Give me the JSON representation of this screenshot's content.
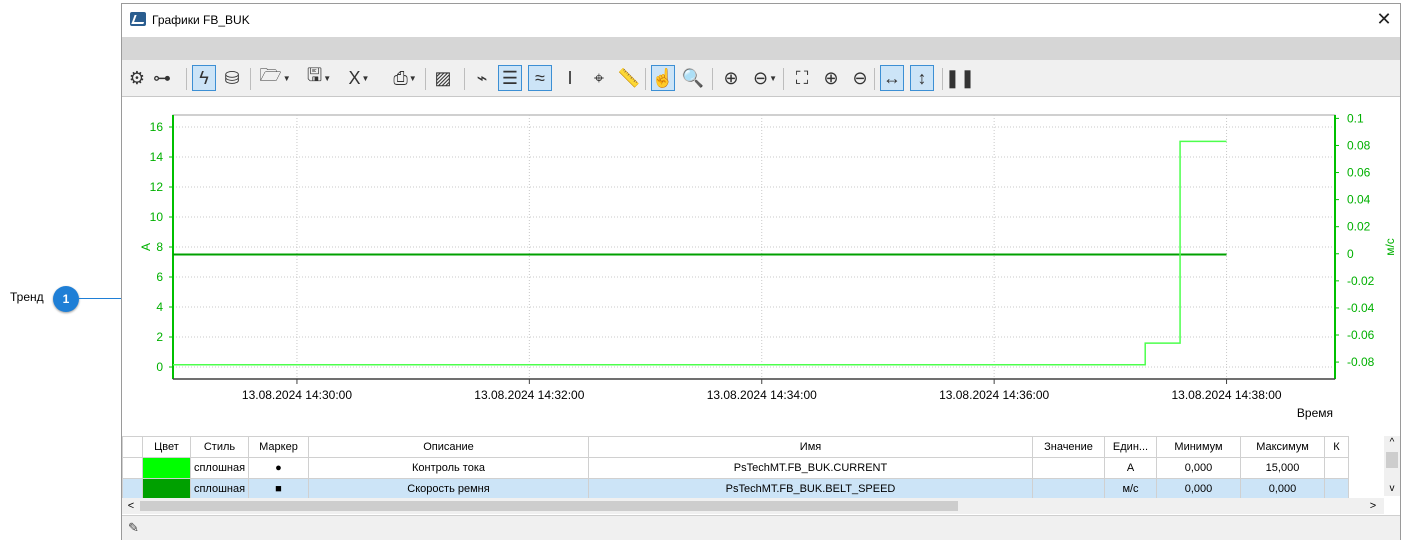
{
  "callout": {
    "label": "Тренд",
    "number": "1"
  },
  "window": {
    "title": "Графики FB_BUK",
    "close": "✕"
  },
  "toolbar": {
    "tools": [
      {
        "icon": "gear-icon",
        "glyph": "⚙"
      },
      {
        "icon": "tree-icon",
        "glyph": "⊶"
      },
      {
        "icon": "lightning-icon",
        "glyph": "ϟ",
        "active": true
      },
      {
        "icon": "database-icon",
        "glyph": "⛁"
      },
      {
        "icon": "folder-open-icon",
        "glyph": "🗁",
        "dropdown": true
      },
      {
        "icon": "save-icon",
        "glyph": "🖫",
        "dropdown": true
      },
      {
        "icon": "excel-icon",
        "glyph": "X",
        "dropdown": true
      },
      {
        "icon": "print-icon",
        "glyph": "⎙",
        "dropdown": true
      },
      {
        "icon": "image-icon",
        "glyph": "▨"
      },
      {
        "icon": "pulse-icon",
        "glyph": "⌁"
      },
      {
        "icon": "list-icon",
        "glyph": "☰",
        "active": true
      },
      {
        "icon": "trend-lines-icon",
        "glyph": "≈",
        "active": true
      },
      {
        "icon": "cursor-text-icon",
        "glyph": "I"
      },
      {
        "icon": "crosshair-icon",
        "glyph": "⌖"
      },
      {
        "icon": "ruler-icon",
        "glyph": "📏"
      },
      {
        "icon": "hand-pointer-icon",
        "glyph": "☝",
        "active": true
      },
      {
        "icon": "magnifier-icon",
        "glyph": "🔍"
      },
      {
        "icon": "add-marker-icon",
        "glyph": "⊕"
      },
      {
        "icon": "remove-marker-icon",
        "glyph": "⊖",
        "dropdown": true
      },
      {
        "icon": "fit-all-icon",
        "glyph": "⛶"
      },
      {
        "icon": "zoom-in-icon",
        "glyph": "⊕"
      },
      {
        "icon": "zoom-out-icon",
        "glyph": "⊖"
      },
      {
        "icon": "horizontal-scale-icon",
        "glyph": "↔",
        "active": true
      },
      {
        "icon": "vertical-scale-icon",
        "glyph": "↕",
        "active": true
      },
      {
        "icon": "pause-icon",
        "glyph": "❚❚"
      }
    ]
  },
  "chart_data": {
    "type": "line",
    "xlabel": "Время",
    "ylabel_left": "А",
    "ylabel_right": "м/с",
    "x_ticks": [
      "13.08.2024 14:30:00",
      "13.08.2024 14:32:00",
      "13.08.2024 14:34:00",
      "13.08.2024 14:36:00",
      "13.08.2024 14:38:00"
    ],
    "x_range": [
      "13.08.2024 14:28:56",
      "13.08.2024 14:38:56"
    ],
    "y_left": {
      "ticks": [
        "0",
        "2",
        "4",
        "6",
        "8",
        "10",
        "12",
        "14",
        "16"
      ],
      "range": [
        -0.8,
        16.8
      ]
    },
    "y_right": {
      "ticks": [
        "-0.08",
        "-0.06",
        "-0.04",
        "-0.02",
        "0",
        "0.02",
        "0.04",
        "0.06",
        "0.08",
        "0.1"
      ],
      "range": [
        -0.0925,
        0.1025
      ]
    },
    "grid": true,
    "series": [
      {
        "name": "Контроль тока",
        "axis": "left",
        "color": "#00a000",
        "points": [
          [
            "14:28:56",
            7.5
          ],
          [
            "14:38:00",
            7.5
          ]
        ]
      },
      {
        "name": "Скорость ремня",
        "axis": "right",
        "color": "#4cff4c",
        "points": [
          [
            "14:28:56",
            -0.082
          ],
          [
            "14:37:18",
            -0.082
          ],
          [
            "14:37:18",
            -0.066
          ],
          [
            "14:37:36",
            -0.066
          ],
          [
            "14:37:36",
            0.083
          ],
          [
            "14:38:00",
            0.083
          ]
        ]
      }
    ]
  },
  "table": {
    "columns": [
      "",
      "Цвет",
      "Стиль",
      "Маркер",
      "Описание",
      "Имя",
      "Значение",
      "Един...",
      "Минимум",
      "Максимум",
      "К"
    ],
    "rows": [
      {
        "color": "#00ff00",
        "style": "сплошная",
        "marker": "●",
        "description": "Контроль тока",
        "name": "PsTechMT.FB_BUK.CURRENT",
        "value": "",
        "unit": "А",
        "min": "0,000",
        "max": "15,000",
        "k": ""
      },
      {
        "color": "#00a000",
        "style": "сплошная",
        "marker": "■",
        "description": "Скорость ремня",
        "name": "PsTechMT.FB_BUK.BELT_SPEED",
        "value": "",
        "unit": "м/с",
        "min": "0,000",
        "max": "0,000",
        "k": ""
      }
    ]
  },
  "status": {
    "icon": "plug-icon",
    "glyph": "✎"
  }
}
